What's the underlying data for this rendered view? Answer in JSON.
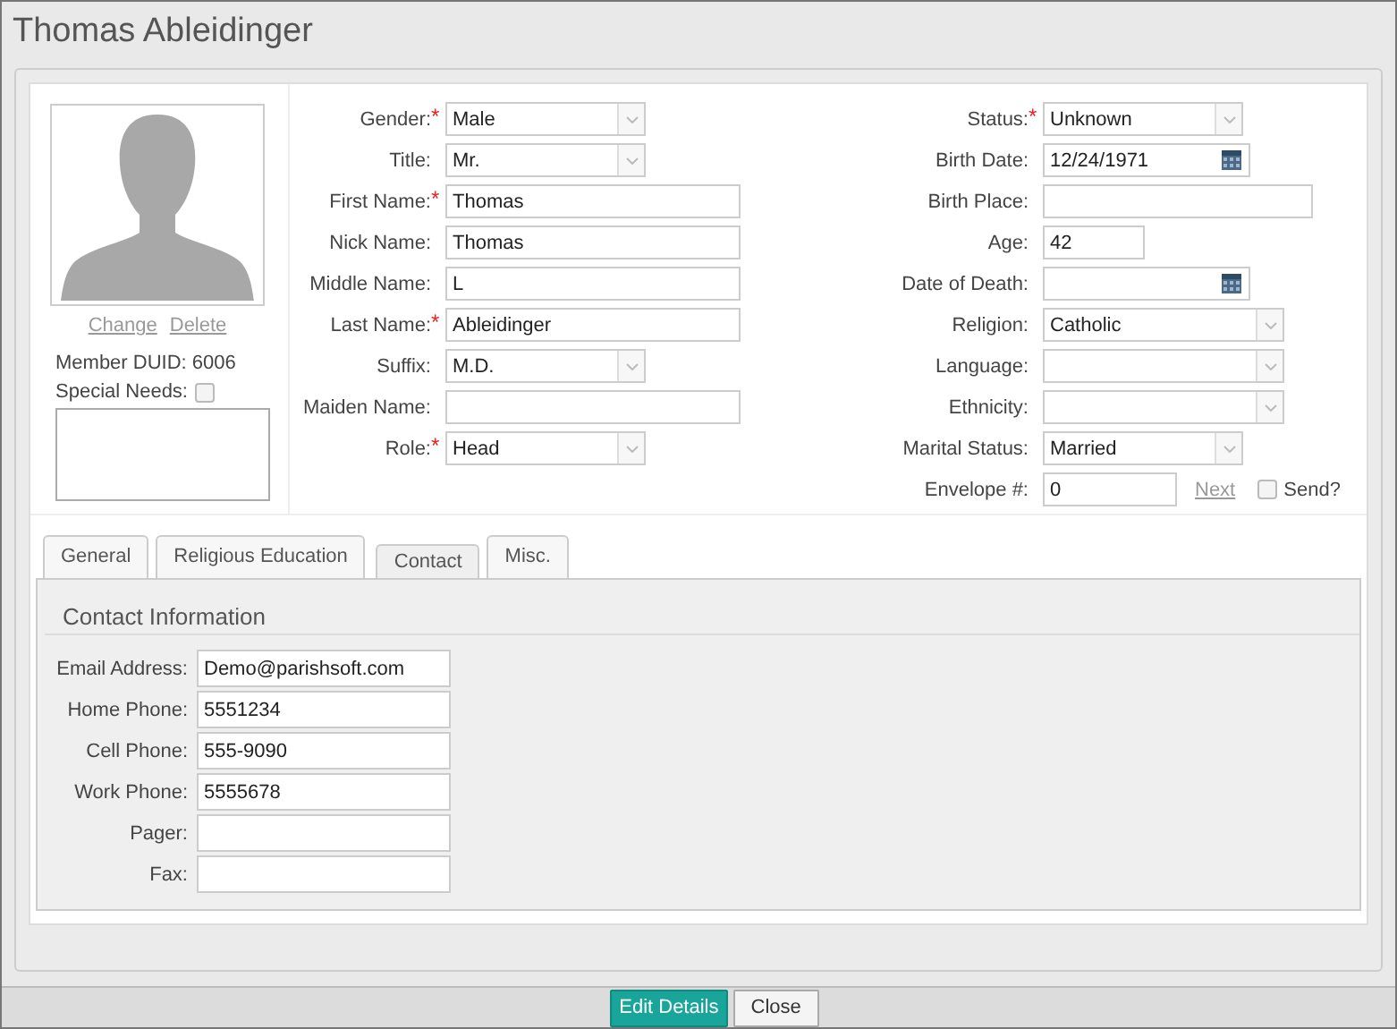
{
  "window": {
    "title": "Thomas Ableidinger"
  },
  "photo": {
    "links": [
      "Change",
      "Delete"
    ],
    "member_duid": "Member DUID: 6006",
    "special_needs": {
      "label": "Special Needs:",
      "checked": false
    }
  },
  "left_fields": [
    {
      "label": "Gender:",
      "required_mark": "*",
      "kind": "select",
      "value": "Male"
    },
    {
      "label": "Title:",
      "kind": "select",
      "value": "Mr."
    },
    {
      "label": "First Name:",
      "required_mark": "*",
      "kind": "text",
      "value": "Thomas"
    },
    {
      "label": "Nick Name:",
      "kind": "text",
      "value": "Thomas"
    },
    {
      "label": "Middle Name:",
      "kind": "text",
      "value": "L"
    },
    {
      "label": "Last Name:",
      "required_mark": "*",
      "kind": "text",
      "value": "Ableidinger"
    },
    {
      "label": "Suffix:",
      "kind": "select",
      "value": "M.D."
    },
    {
      "label": "Maiden Name:",
      "kind": "text"
    },
    {
      "label": "Role:",
      "required_mark": "*",
      "kind": "select",
      "value": "Head"
    }
  ],
  "right_fields": [
    {
      "label": "Status:",
      "required_mark": "*",
      "kind": "select",
      "value": "Unknown"
    },
    {
      "label": "Birth Date:",
      "kind": "date",
      "value": "12/24/1971"
    },
    {
      "label": "Birth Place:",
      "kind": "text"
    },
    {
      "label": "Age:",
      "kind": "text",
      "value": "42"
    },
    {
      "label": "Date of Death:",
      "kind": "date"
    },
    {
      "label": "Religion:",
      "kind": "select",
      "value": "Catholic"
    },
    {
      "label": "Language:",
      "kind": "select"
    },
    {
      "label": "Ethnicity:",
      "kind": "select"
    },
    {
      "label": "Marital Status:",
      "kind": "select",
      "value": "Married"
    },
    {
      "label": "Envelope #:",
      "kind": "envelope",
      "value": "0",
      "link": "Next",
      "checkbox": {
        "label": "Send?",
        "checked": false
      }
    }
  ],
  "tabs": [
    {
      "label": "General",
      "selected": false
    },
    {
      "label": "Religious Education",
      "selected": false
    },
    {
      "label": "Contact",
      "selected": true
    },
    {
      "label": "Misc.",
      "selected": false
    }
  ],
  "contact": {
    "heading": "Contact Information",
    "fields": [
      {
        "label": "Email Address:",
        "value": "Demo@parishsoft.com"
      },
      {
        "label": "Home Phone:",
        "value": "5551234"
      },
      {
        "label": "Cell Phone:",
        "value": "555-9090"
      },
      {
        "label": "Work Phone:",
        "value": "5555678"
      },
      {
        "label": "Pager:"
      },
      {
        "label": "Fax:"
      }
    ]
  },
  "buttons": [
    {
      "label": "Edit Details",
      "kind": "primary"
    },
    {
      "label": "Close",
      "kind": "default"
    }
  ]
}
